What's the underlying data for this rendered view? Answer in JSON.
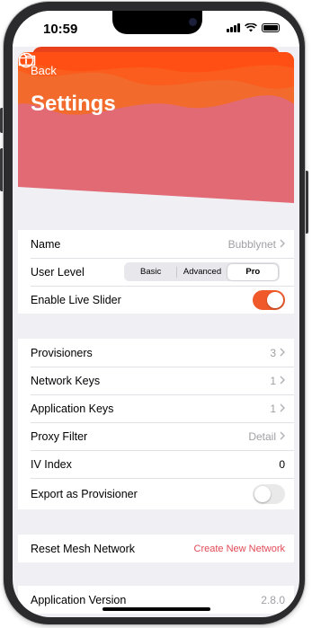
{
  "status_bar": {
    "time": "10:59"
  },
  "nav": {
    "back_label": "Back",
    "title": "Settings",
    "folder_icon": "folder-icon",
    "info_icon": "info-icon"
  },
  "section1": {
    "name": {
      "label": "Name",
      "value": "Bubblynet"
    },
    "user_level": {
      "label": "User Level",
      "options": [
        "Basic",
        "Advanced",
        "Pro"
      ],
      "selected": "Pro"
    },
    "live_slider": {
      "label": "Enable Live Slider",
      "on": true
    }
  },
  "section2": {
    "provisioners": {
      "label": "Provisioners",
      "value": "3"
    },
    "network_keys": {
      "label": "Network Keys",
      "value": "1"
    },
    "application_keys": {
      "label": "Application Keys",
      "value": "1"
    },
    "proxy_filter": {
      "label": "Proxy Filter",
      "value": "Detail"
    },
    "iv_index": {
      "label": "IV Index",
      "value": "0"
    },
    "export_provisioner": {
      "label": "Export as Provisioner",
      "on": false
    }
  },
  "section3": {
    "reset_label": "Reset Mesh Network",
    "create_label": "Create New Network"
  },
  "section4": {
    "version_label": "Application Version",
    "version_value": "2.8.0"
  },
  "colors": {
    "accent": "#f26b2c",
    "toggle_on": "#f05a2a",
    "destructive": "#e24a57"
  }
}
